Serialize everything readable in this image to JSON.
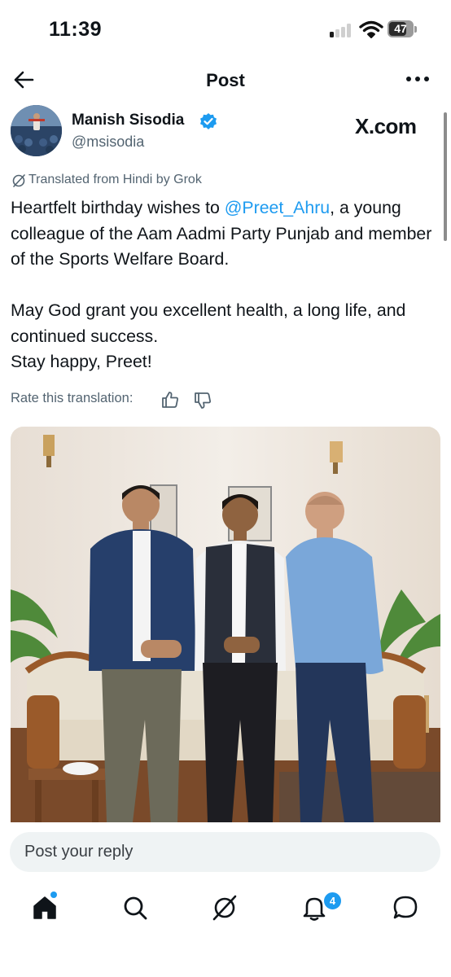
{
  "status_bar": {
    "time": "11:39",
    "battery": "47"
  },
  "header": {
    "title": "Post"
  },
  "author": {
    "name": "Manish Sisodia",
    "handle": "@msisodia"
  },
  "brand": "X.com",
  "translation": {
    "notice": "Translated from Hindi by Grok",
    "rate_label": "Rate this translation:"
  },
  "post": {
    "line1_before": "Heartfelt birthday wishes to ",
    "mention": "@Preet_Ahru",
    "line1_after": ", a young colleague of the Aam Aadmi Party Punjab and member of the Sports Welfare Board.",
    "paragraph2": "May God grant you excellent health, a long life, and continued success.",
    "paragraph3": "Stay happy, Preet!"
  },
  "reply": {
    "placeholder": "Post your reply"
  },
  "nav": {
    "notifications_badge": "4"
  },
  "colors": {
    "accent": "#1d9bf0",
    "text": "#0f1419",
    "secondary": "#536471",
    "reply_bg": "#eff3f4"
  }
}
